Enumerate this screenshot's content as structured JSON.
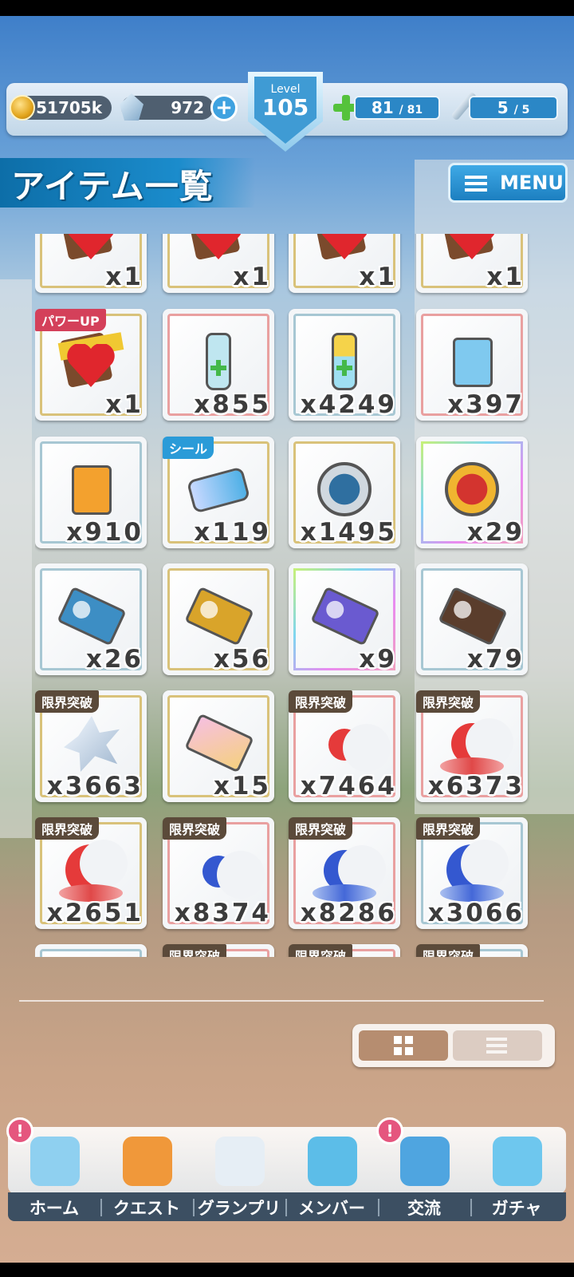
{
  "status": {
    "coins": "51705k",
    "gems": "972",
    "level_label": "Level",
    "level": "105",
    "stamina_current": "81",
    "stamina_max": "/ 81",
    "battle_current": "5",
    "battle_max": "/ 5"
  },
  "header": {
    "title": "アイテム一覧",
    "menu_label": "MENU"
  },
  "items": [
    {
      "name": "chocolate-heart",
      "qty": "x1",
      "badge": "",
      "frame": "gold"
    },
    {
      "name": "chocolate-heart",
      "qty": "x1",
      "badge": "",
      "frame": "gold"
    },
    {
      "name": "chocolate-heart",
      "qty": "x1",
      "badge": "",
      "frame": "gold"
    },
    {
      "name": "chocolate-heart",
      "qty": "x1",
      "badge": "",
      "frame": "gold"
    },
    {
      "name": "chocolate-heart",
      "qty": "x1",
      "badge": "パワーUP",
      "frame": "gold"
    },
    {
      "name": "stamina-drink",
      "qty": "x855",
      "badge": "",
      "frame": "pink"
    },
    {
      "name": "stamina-drink-large",
      "qty": "x4249",
      "badge": "",
      "frame": "blue"
    },
    {
      "name": "jelly-pouch",
      "qty": "x397",
      "badge": "",
      "frame": "pink"
    },
    {
      "name": "jelly-pouch-orange",
      "qty": "x910",
      "badge": "",
      "frame": "blue"
    },
    {
      "name": "seal-reset",
      "qty": "x119",
      "badge": "シール",
      "frame": "gold"
    },
    {
      "name": "silver-medal",
      "qty": "x1495",
      "badge": "",
      "frame": "gold"
    },
    {
      "name": "gold-medal",
      "qty": "x29",
      "badge": "",
      "frame": "rainbow"
    },
    {
      "name": "gacha-ticket-blue",
      "qty": "x26",
      "badge": "",
      "frame": "blue"
    },
    {
      "name": "gacha-ticket-gold",
      "qty": "x56",
      "badge": "",
      "frame": "gold"
    },
    {
      "name": "gacha-ticket-rainbow",
      "qty": "x9",
      "badge": "",
      "frame": "rainbow"
    },
    {
      "name": "revival-ticket",
      "qty": "x79",
      "badge": "",
      "frame": "blue"
    },
    {
      "name": "limit-crystal",
      "qty": "x3663",
      "badge": "限界突破",
      "frame": "gold"
    },
    {
      "name": "pose-ticket",
      "qty": "x15",
      "badge": "",
      "frame": "gold"
    },
    {
      "name": "red-moon-small",
      "qty": "x7464",
      "badge": "限界突破",
      "frame": "pink"
    },
    {
      "name": "red-moon-medium",
      "qty": "x6373",
      "badge": "限界突破",
      "frame": "pink"
    },
    {
      "name": "red-moon-large",
      "qty": "x2651",
      "badge": "限界突破",
      "frame": "gold"
    },
    {
      "name": "blue-moon-small",
      "qty": "x8374",
      "badge": "限界突破",
      "frame": "pink"
    },
    {
      "name": "blue-moon-medium",
      "qty": "x8286",
      "badge": "限界突破",
      "frame": "pink"
    },
    {
      "name": "blue-moon-large",
      "qty": "x3066",
      "badge": "限界突破",
      "frame": "blue"
    },
    {
      "name": "partial-item",
      "qty": "",
      "badge": "",
      "frame": "blue"
    },
    {
      "name": "partial-item",
      "qty": "",
      "badge": "限界突破",
      "frame": "pink"
    },
    {
      "name": "partial-item",
      "qty": "",
      "badge": "限界突破",
      "frame": "pink"
    },
    {
      "name": "partial-item",
      "qty": "",
      "badge": "限界突破",
      "frame": "blue"
    }
  ],
  "view_toggle": {
    "grid_icon": "grid-icon",
    "list_icon": "list-icon",
    "selected": "grid"
  },
  "nav": [
    {
      "label": "ホーム",
      "icon": "school-icon",
      "alert": "!",
      "color": "#8fd0f0"
    },
    {
      "label": "クエスト",
      "icon": "demon-icon",
      "alert": "",
      "color": "#f0983a"
    },
    {
      "label": "グランプリ",
      "icon": "crossed-swords-icon",
      "alert": "",
      "color": "#e6eef5"
    },
    {
      "label": "メンバー",
      "icon": "member-icon",
      "alert": "",
      "color": "#5cbde8"
    },
    {
      "label": "交流",
      "icon": "map-pin-icon",
      "alert": "!",
      "color": "#4fa5e0"
    },
    {
      "label": "ガチャ",
      "icon": "curtain-icon",
      "alert": "",
      "color": "#6ec7ee"
    }
  ]
}
